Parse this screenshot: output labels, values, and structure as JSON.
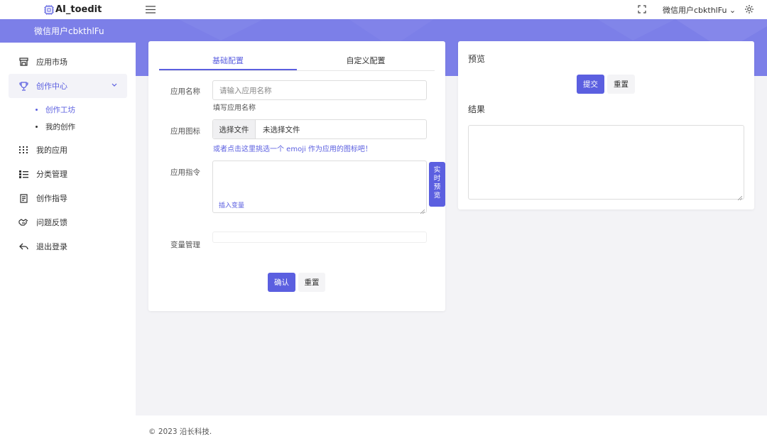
{
  "app": {
    "name": "AI_toedit"
  },
  "user": {
    "name": "微信用户cbkthlFu",
    "menu_label": "微信用户cbkthlFu ⌄"
  },
  "sidebar": {
    "items": [
      {
        "label": "应用市场",
        "icon": "store-icon"
      },
      {
        "label": "创作中心",
        "icon": "trophy-icon",
        "active": true
      },
      {
        "label": "我的应用",
        "icon": "grid-icon"
      },
      {
        "label": "分类管理",
        "icon": "list-icon"
      },
      {
        "label": "创作指导",
        "icon": "document-icon"
      },
      {
        "label": "问题反馈",
        "icon": "handshake-icon"
      },
      {
        "label": "退出登录",
        "icon": "reply-icon"
      }
    ],
    "subitems": [
      {
        "label": "创作工坊",
        "active": true
      },
      {
        "label": "我的创作"
      }
    ],
    "expand_icon": "chevron-down-icon"
  },
  "form": {
    "tabs": [
      {
        "label": "基础配置"
      },
      {
        "label": "自定义配置"
      }
    ],
    "app_name_label": "应用名称",
    "app_name_placeholder": "请输入应用名称",
    "app_name_help": "填写应用名称",
    "app_icon_label": "应用图标",
    "file_button": "选择文件",
    "file_status": "未选择文件",
    "emoji_link": "或者点击这里挑选一个 emoji 作为应用的图标吧！",
    "prompt_label": "应用指令",
    "insert_variable": "插入变量",
    "live_preview": "实时预览",
    "variables_label": "变量管理",
    "confirm": "确认",
    "reset": "重置"
  },
  "preview": {
    "title": "预览",
    "submit": "提交",
    "reset": "重置",
    "result_title": "结果"
  },
  "footer": {
    "copyright": "© 2023 沿长科技."
  },
  "colors": {
    "accent": "#5b5fe0",
    "banner": "#7c7fe8"
  }
}
